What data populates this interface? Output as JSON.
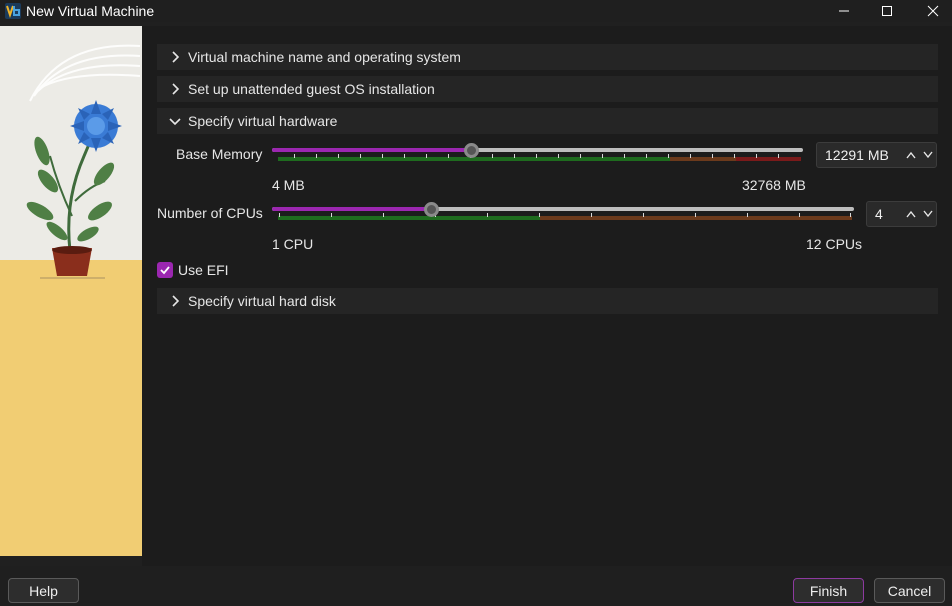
{
  "window": {
    "title": "New Virtual Machine",
    "icons": [
      "app-logo-icon",
      "minimize-icon",
      "maximize-icon",
      "close-icon"
    ]
  },
  "sections": [
    {
      "label": "Virtual machine name and operating system",
      "expanded": false
    },
    {
      "label": "Set up unattended guest OS installation",
      "expanded": false
    },
    {
      "label": "Specify virtual hardware",
      "expanded": true
    },
    {
      "label": "Specify virtual hard disk",
      "expanded": false
    }
  ],
  "hardware": {
    "memory": {
      "label": "Base Memory",
      "value": 12291,
      "value_text": "12291 MB",
      "min": 4,
      "max": 32768,
      "min_label": "4 MB",
      "max_label": "32768 MB"
    },
    "cpus": {
      "label": "Number of CPUs",
      "value": 4,
      "value_text": "4",
      "min": 1,
      "max": 12,
      "min_label": "1 CPU",
      "max_label": "12 CPUs"
    },
    "efi": {
      "label": "Use EFI",
      "checked": true
    }
  },
  "footer": {
    "help": "Help",
    "finish": "Finish",
    "cancel": "Cancel"
  },
  "colors": {
    "accent": "#9b27b0",
    "zone_ok": "#1e6b1e",
    "zone_warn": "#6b3a1c",
    "zone_bad": "#7a1a1a"
  }
}
